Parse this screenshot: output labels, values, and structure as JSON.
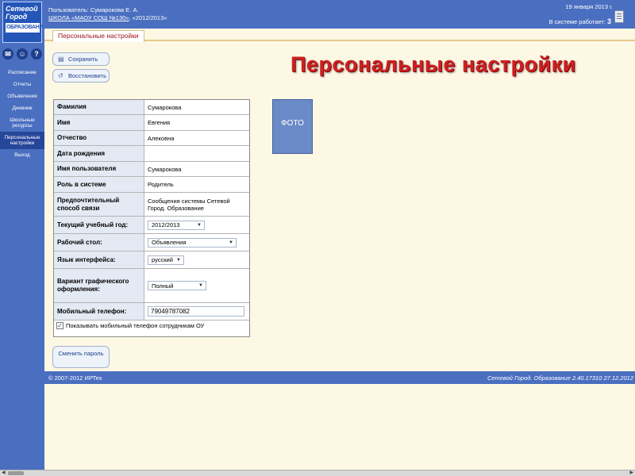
{
  "sidebar": {
    "logo": {
      "line1": "Сетевой",
      "line2": "Город",
      "line3": "ОБРАЗОВАНИ"
    },
    "icons": [
      {
        "name": "mail-icon",
        "glyph": "✉"
      },
      {
        "name": "users-icon",
        "glyph": "☺"
      },
      {
        "name": "help-icon",
        "glyph": "?"
      }
    ],
    "items": [
      {
        "label": "Расписание"
      },
      {
        "label": "Отчеты"
      },
      {
        "label": "Объявления"
      },
      {
        "label": "Дневник"
      },
      {
        "label": "Школьные ресурсы"
      },
      {
        "label": "Персональные настройки"
      },
      {
        "label": "Выход"
      }
    ]
  },
  "header": {
    "user_line": "Пользователь: Сумарокова Е. А.",
    "school_link": "ШКОЛА «МАОУ СОШ №130»",
    "year": ", «2012/2013»",
    "date": "19 января 2013 г.",
    "online_label": "В системе работает:",
    "online_count": "3"
  },
  "tab": {
    "label": "Персональные настройки"
  },
  "toolbar": {
    "save_label": "Сохранить",
    "restore_label": "Восстановить"
  },
  "page_title": "Персональные настройки",
  "form": {
    "surname_label": "Фамилия",
    "surname_value": "Сумарокова",
    "name_label": "Имя",
    "name_value": "Евгения",
    "patronymic_label": "Отчество",
    "patronymic_value": "Алековна",
    "birthdate_label": "Дата рождения",
    "birthdate_value": "",
    "username_label": "Имя пользователя",
    "username_value": "Сумарокова",
    "role_label": "Роль в системе",
    "role_value": "Родитель",
    "contact_label": "Предпочтительный способ связи",
    "contact_value": "Сообщения системы Сетевой Город. Образование",
    "year_label": "Текущий учебный год:",
    "year_value": "2012/2013",
    "desktop_label": "Рабочий стол:",
    "desktop_value": "Объявления",
    "lang_label": "Язык интерфейса:",
    "lang_value": "русский",
    "theme_label": "Вариант графического оформления:",
    "theme_value": "Полный",
    "phone_label": "Мобильный телефон:",
    "phone_value": "79049787082",
    "show_phone_label": "Показывать мобильный телефон сотрудникам ОУ",
    "show_phone_checked": "✓"
  },
  "photo": {
    "label": "ФОТО"
  },
  "change_password": {
    "label": "Сменить пароль"
  },
  "footer": {
    "left": "© 2007-2012 ИРТех",
    "right": "Сетевой Город. Образование 2.40.17310   27.12.2012"
  }
}
